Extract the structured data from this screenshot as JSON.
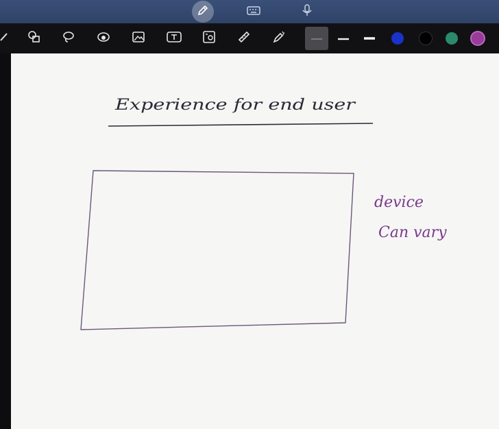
{
  "mode_bar": {
    "modes": [
      {
        "icon": "pen-mode-icon",
        "active": true
      },
      {
        "icon": "keyboard-icon",
        "active": false
      },
      {
        "icon": "microphone-icon",
        "active": false
      }
    ]
  },
  "toolbar": {
    "tools": [
      "pencil-icon",
      "shapes-icon",
      "lasso-icon",
      "eraser-icon",
      "insert-image-icon",
      "text-box-icon",
      "photo-icon",
      "ruler-icon",
      "highlighter-icon"
    ],
    "pen_styles": [
      "thin-line",
      "medium-line",
      "thick-line"
    ],
    "colors": [
      "#1a32c8",
      "#000000",
      "#2a8a6a",
      "#9a3a9a"
    ]
  },
  "canvas": {
    "heading": "Experience for end user",
    "note_line1": "device",
    "note_line2": "Can vary",
    "ink_color": "#2a2a35",
    "note_color": "#7a3a8a"
  }
}
